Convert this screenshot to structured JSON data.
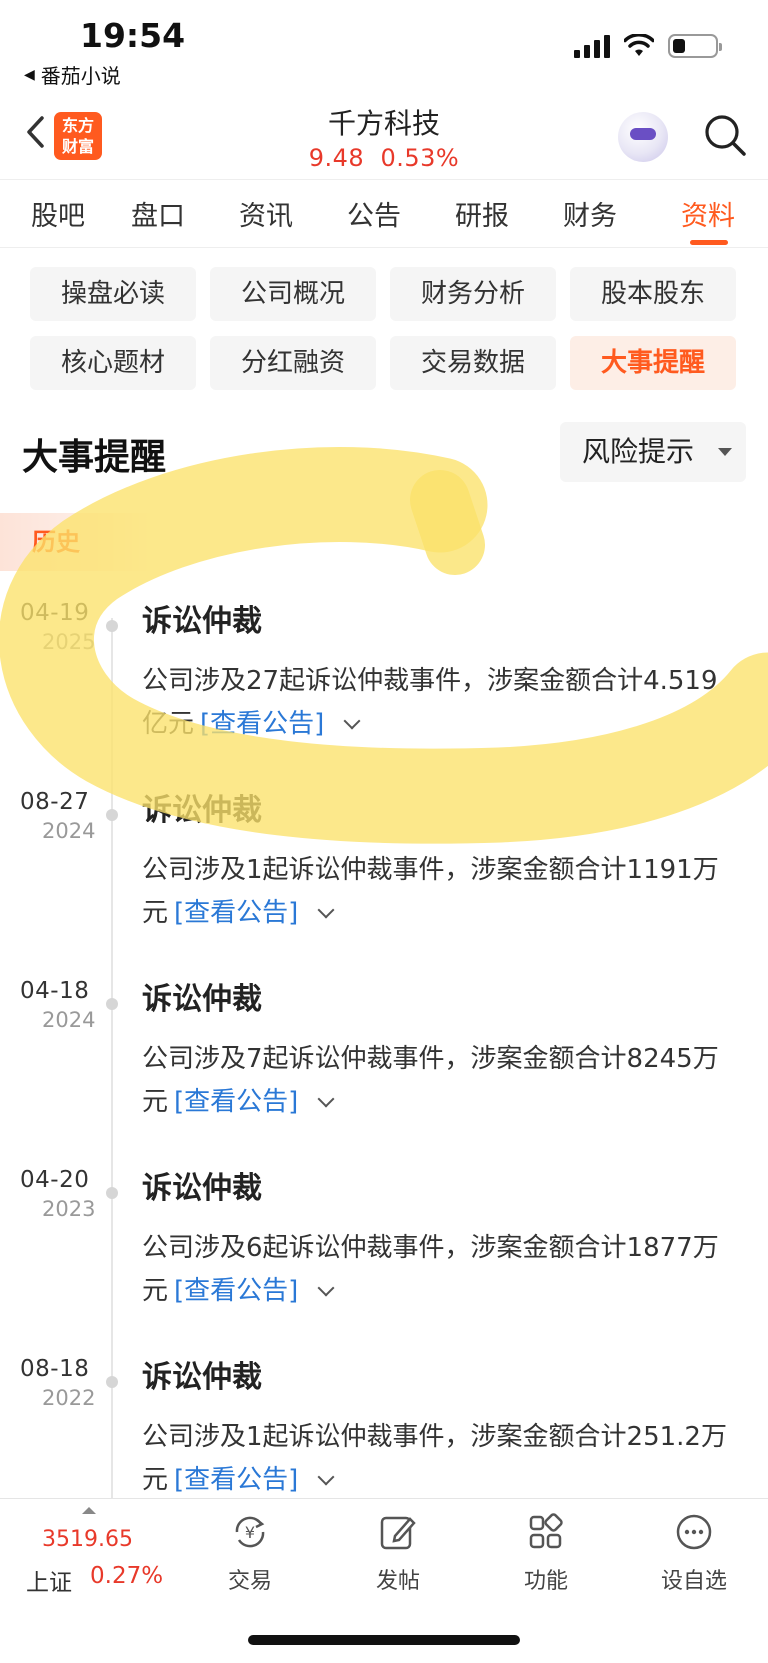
{
  "status_bar": {
    "time": "19:54",
    "back_app": "番茄小说",
    "battery_level": 0.3
  },
  "header": {
    "logo_text": [
      "东方",
      "财富"
    ],
    "title": "千方科技",
    "price": "9.48",
    "change_pct": "0.53%",
    "icons": [
      "back-icon",
      "robot-assistant-icon",
      "search-icon"
    ]
  },
  "tabs": [
    {
      "label": "股吧"
    },
    {
      "label": "盘口"
    },
    {
      "label": "资讯"
    },
    {
      "label": "公告"
    },
    {
      "label": "研报"
    },
    {
      "label": "财务"
    },
    {
      "label": "资料",
      "active": true
    }
  ],
  "sub_tabs": [
    {
      "label": "操盘必读"
    },
    {
      "label": "公司概况"
    },
    {
      "label": "财务分析"
    },
    {
      "label": "股本股东"
    },
    {
      "label": "核心题材"
    },
    {
      "label": "分红融资"
    },
    {
      "label": "交易数据"
    },
    {
      "label": "大事提醒",
      "active": true
    }
  ],
  "section": {
    "title": "大事提醒",
    "filter_label": "风险提示",
    "history_label": "历史"
  },
  "events": [
    {
      "date": "04-19",
      "year": "2025",
      "title": "诉讼仲裁",
      "desc": "公司涉及27起诉讼仲裁事件，涉案金额合计4.519亿元",
      "link": "[查看公告]"
    },
    {
      "date": "08-27",
      "year": "2024",
      "title": "诉讼仲裁",
      "desc": "公司涉及1起诉讼仲裁事件，涉案金额合计1191万元",
      "link": "[查看公告]"
    },
    {
      "date": "04-18",
      "year": "2024",
      "title": "诉讼仲裁",
      "desc": "公司涉及7起诉讼仲裁事件，涉案金额合计8245万元",
      "link": "[查看公告]"
    },
    {
      "date": "04-20",
      "year": "2023",
      "title": "诉讼仲裁",
      "desc": "公司涉及6起诉讼仲裁事件，涉案金额合计1877万元",
      "link": "[查看公告]"
    },
    {
      "date": "08-18",
      "year": "2022",
      "title": "诉讼仲裁",
      "desc": "公司涉及1起诉讼仲裁事件，涉案金额合计251.2万元",
      "link": "[查看公告]"
    }
  ],
  "bottom_bar": {
    "index_value": "3519.65",
    "index_name": "上证",
    "index_pct": "0.27%",
    "items": [
      {
        "label": "交易",
        "icon": "trade-yen-icon"
      },
      {
        "label": "发帖",
        "icon": "compose-icon"
      },
      {
        "label": "功能",
        "icon": "apps-grid-icon"
      },
      {
        "label": "设自选",
        "icon": "more-dots-icon"
      }
    ]
  },
  "colors": {
    "accent": "#ff5a1f",
    "up_red": "#e8392a",
    "link_blue": "#2a78d6",
    "marker_yellow": "#fbe26a"
  }
}
